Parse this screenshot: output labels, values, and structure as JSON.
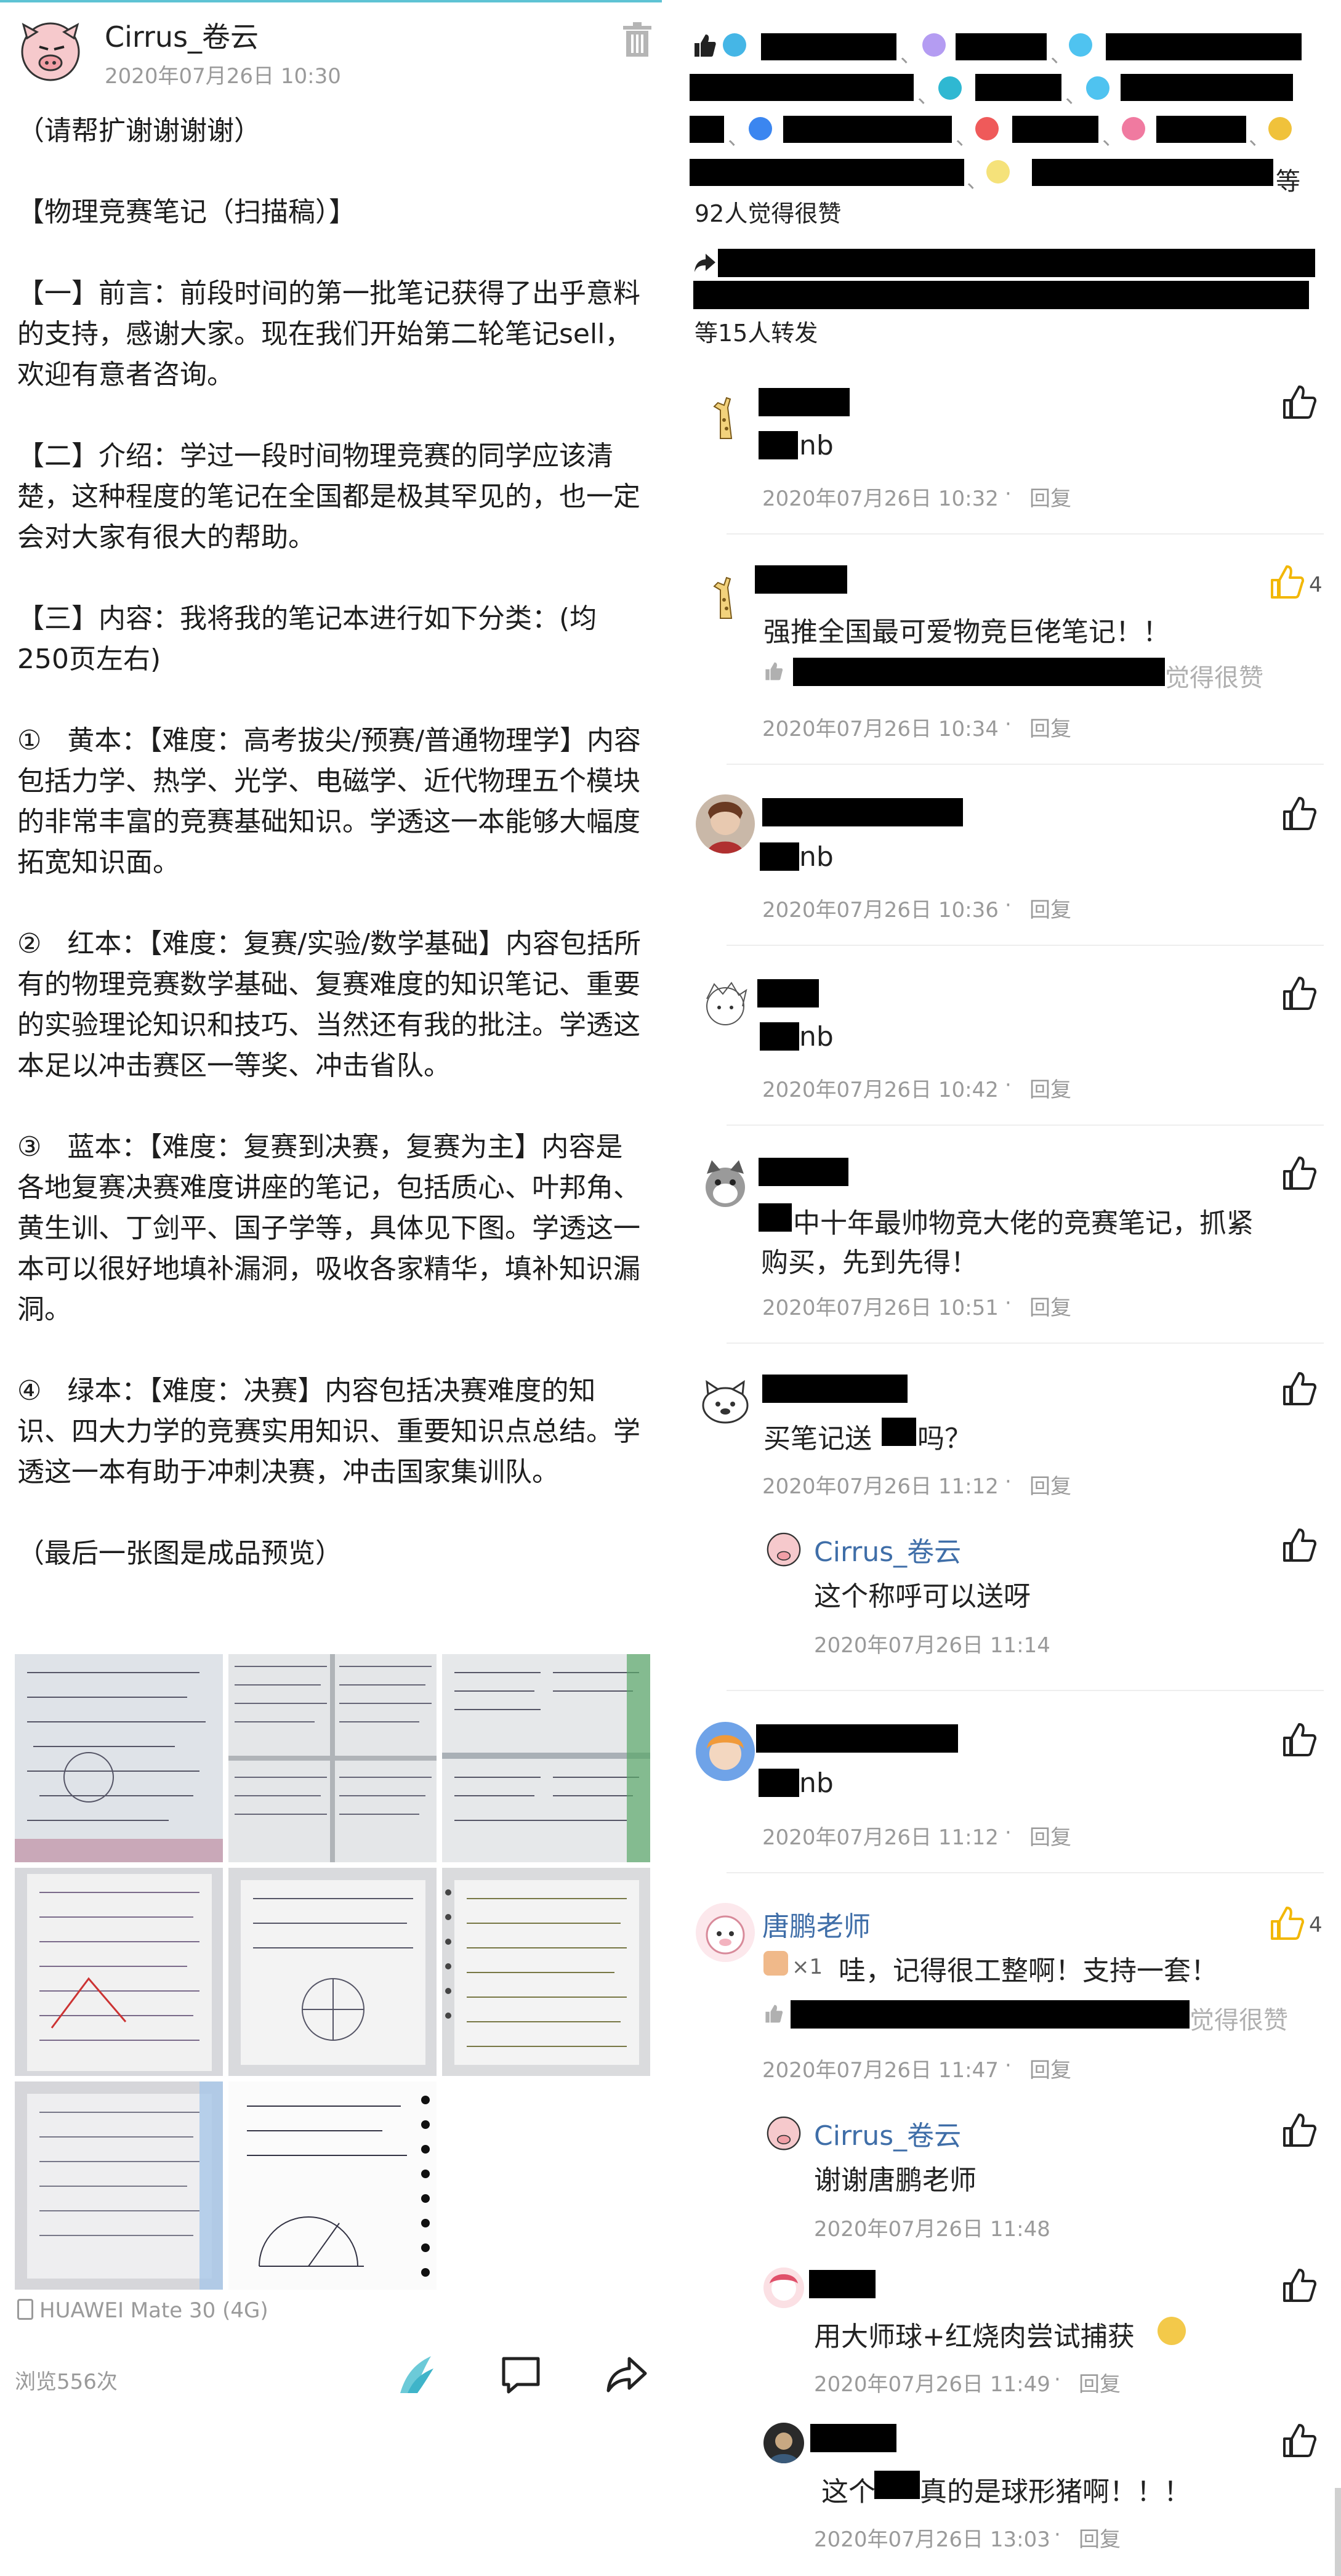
{
  "post": {
    "author": "Cirrus_卷云",
    "time": "2020年07月26日 10:30",
    "body": "（请帮扩谢谢谢谢）\n\n【物理竞赛笔记（扫描稿）】\n\n【一】前言：前段时间的第一批笔记获得了出乎意料的支持，感谢大家。现在我们开始第二轮笔记sell，欢迎有意者咨询。\n\n【二】介绍：学过一段时间物理竞赛的同学应该清楚，这种程度的笔记在全国都是极其罕见的，也一定会对大家有很大的帮助。\n\n【三】内容：我将我的笔记本进行如下分类：(均250页左右)\n\n①   黄本：【难度：高考拔尖/预赛/普通物理学】内容包括力学、热学、光学、电磁学、近代物理五个模块的非常丰富的竞赛基础知识。学透这一本能够大幅度拓宽知识面。\n\n②   红本：【难度：复赛/实验/数学基础】内容包括所有的物理竞赛数学基础、复赛难度的知识笔记、重要的实验理论知识和技巧、当然还有我的批注。学透这本足以冲击赛区一等奖、冲击省队。\n\n③   蓝本：【难度：复赛到决赛，复赛为主】内容是各地复赛决赛难度讲座的笔记，包括质心、叶邦角、黄生训、丁剑平、国子学等，具体见下图。学透这一本可以很好地填补漏洞，吸收各家精华，填补知识漏洞。\n\n④   绿本：【难度：决赛】内容包括决赛难度的知识、四大力学的竞赛实用知识、重要知识点总结。学透这一本有助于冲刺决赛，冲击国家集训队。\n\n（最后一张图是成品预览）",
    "device": "HUAWEI Mate 30 (4G)",
    "views": "浏览556次"
  },
  "likes": {
    "summary": "92人觉得很赞",
    "suffix": "等",
    "sep": "、"
  },
  "shares": {
    "summary": "等15人转发"
  },
  "comments": [
    {
      "text": "nb",
      "time": "2020年07月26日 10:32",
      "reply": "回复",
      "likes": ""
    },
    {
      "text": "强推全国最可爱物竞巨佬笔记！！",
      "time": "2020年07月26日 10:34",
      "reply": "回复",
      "likes": "4",
      "liked_suffix": "觉得很赞"
    },
    {
      "text": "nb",
      "time": "2020年07月26日 10:36",
      "reply": "回复"
    },
    {
      "text": "nb",
      "time": "2020年07月26日 10:42",
      "reply": "回复"
    },
    {
      "text_a": "中十年最帅物竞大佬的竞赛笔记，抓紧",
      "text_b": "购买，先到先得！",
      "time": "2020年07月26日 10:51",
      "reply": "回复"
    },
    {
      "text_a": "买笔记送",
      "text_b": "吗？",
      "time": "2020年07月26日 11:12",
      "reply": "回复",
      "sub": {
        "name": "Cirrus_卷云",
        "text": "这个称呼可以送呀",
        "time": "2020年07月26日 11:14"
      }
    },
    {
      "text": "nb",
      "time": "2020年07月26日 11:12",
      "reply": "回复"
    },
    {
      "name": "唐鹏老师",
      "badge": "×1",
      "text": "哇，记得很工整啊！支持一套！",
      "time": "2020年07月26日 11:47",
      "reply": "回复",
      "likes": "4",
      "liked_suffix": "觉得很赞",
      "subs": [
        {
          "name": "Cirrus_卷云",
          "text": "谢谢唐鹏老师",
          "time": "2020年07月26日 11:48"
        },
        {
          "text": "用大师球+红烧肉尝试捕获",
          "time": "2020年07月26日 11:49",
          "reply": "回复"
        },
        {
          "text_a": "这个",
          "text_b": "真的是球形猪啊！！！",
          "time": "2020年07月26日 13:03",
          "reply": "回复"
        }
      ]
    }
  ],
  "colors": {
    "accent": "#5ec3d4",
    "link": "#3f6ea8",
    "like_active": "#f2b705",
    "meta": "#9a9a9a"
  }
}
